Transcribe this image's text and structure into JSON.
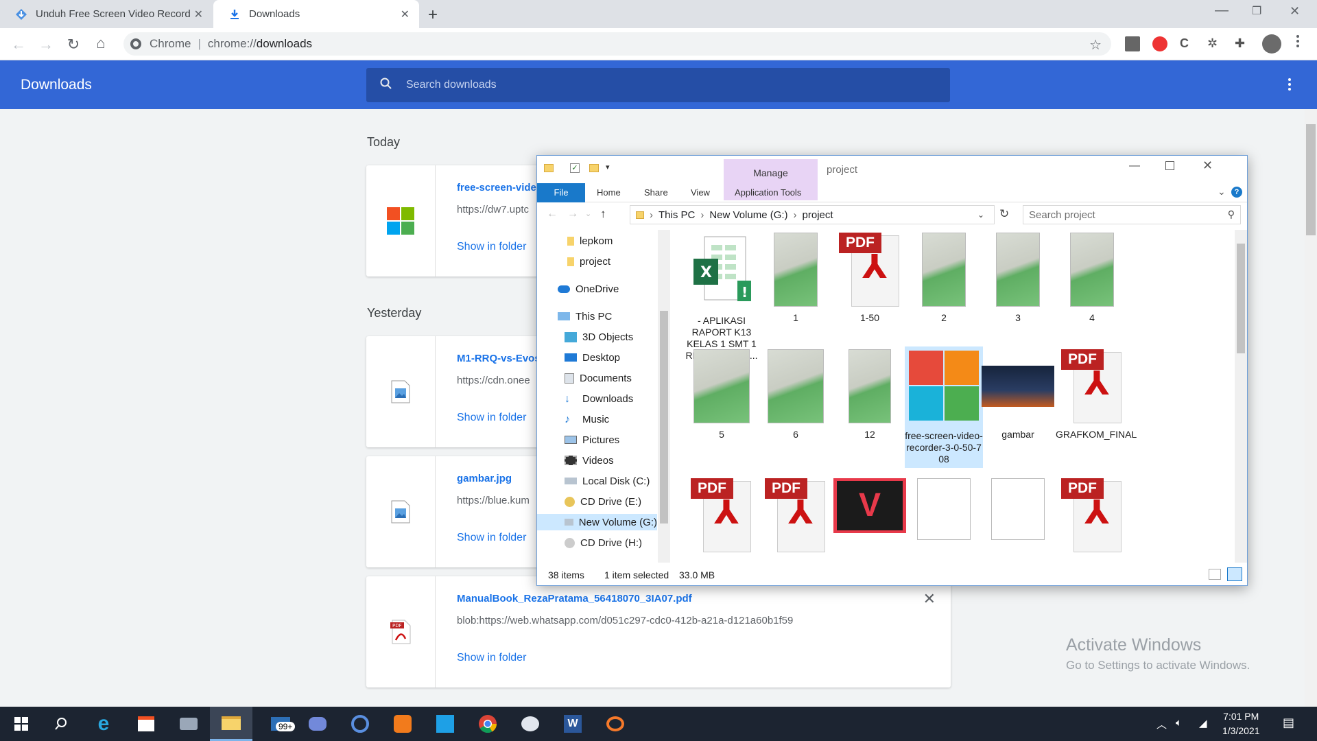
{
  "browser": {
    "tabs": [
      {
        "label": "Unduh Free Screen Video Record",
        "active": false
      },
      {
        "label": "Downloads",
        "active": true
      }
    ],
    "omnibox": {
      "site": "Chrome",
      "url_prefix": "chrome://",
      "url_path": "downloads"
    }
  },
  "downloads": {
    "title": "Downloads",
    "search_placeholder": "Search downloads",
    "sections": [
      {
        "label": "Today",
        "items": [
          {
            "name": "free-screen-vide",
            "url": "https://dw7.uptc",
            "action": "Show in folder",
            "icon": "windows-installer-icon"
          }
        ]
      },
      {
        "label": "Yesterday",
        "items": [
          {
            "name": "M1-RRQ-vs-Evos",
            "url": "https://cdn.onee",
            "action": "Show in folder",
            "icon": "image-file-icon"
          },
          {
            "name": "gambar.jpg",
            "url": "https://blue.kum",
            "action": "Show in folder",
            "icon": "image-file-icon"
          },
          {
            "name": "ManualBook_RezaPratama_56418070_3IA07.pdf",
            "url": "blob:https://web.whatsapp.com/d051c297-cdc0-412b-a21a-d121a60b1f59",
            "action": "Show in folder",
            "icon": "pdf-file-icon"
          }
        ]
      }
    ]
  },
  "explorer": {
    "window_title": "project",
    "context_tab": "Manage",
    "ribbon_tabs": [
      "File",
      "Home",
      "Share",
      "View",
      "Application Tools"
    ],
    "breadcrumb": [
      "This PC",
      "New Volume (G:)",
      "project"
    ],
    "search_placeholder": "Search project",
    "nav": [
      {
        "label": "lepkom",
        "icon": "folder-icon"
      },
      {
        "label": "project",
        "icon": "folder-icon"
      },
      {
        "label": "OneDrive",
        "icon": "onedrive-icon"
      },
      {
        "label": "This PC",
        "icon": "computer-icon"
      },
      {
        "label": "3D Objects",
        "icon": "cube-icon"
      },
      {
        "label": "Desktop",
        "icon": "desktop-icon"
      },
      {
        "label": "Documents",
        "icon": "documents-icon"
      },
      {
        "label": "Downloads",
        "icon": "download-arrow-icon"
      },
      {
        "label": "Music",
        "icon": "music-note-icon"
      },
      {
        "label": "Pictures",
        "icon": "pictures-icon"
      },
      {
        "label": "Videos",
        "icon": "film-icon"
      },
      {
        "label": "Local Disk (C:)",
        "icon": "drive-icon"
      },
      {
        "label": "CD Drive (E:)",
        "icon": "cd-icon"
      },
      {
        "label": "New Volume (G:)",
        "icon": "drive-icon",
        "selected": true
      },
      {
        "label": "CD Drive (H:)",
        "icon": "cd-icon"
      }
    ],
    "files": [
      {
        "label": "- APLIKASI RAPORT K13 KELAS 1 SMT 1 REVISI 2018 - ...",
        "type": "excel"
      },
      {
        "label": "1",
        "type": "photo"
      },
      {
        "label": "1-50",
        "type": "pdf"
      },
      {
        "label": "2",
        "type": "photo"
      },
      {
        "label": "3",
        "type": "photo"
      },
      {
        "label": "4",
        "type": "photo"
      },
      {
        "label": "5",
        "type": "photo"
      },
      {
        "label": "6",
        "type": "photo"
      },
      {
        "label": "12",
        "type": "photo"
      },
      {
        "label": "free-screen-video-recorder-3-0-50-708",
        "type": "installer",
        "selected": true
      },
      {
        "label": "gambar",
        "type": "image"
      },
      {
        "label": "GRAFKOM_FINAL",
        "type": "pdf"
      }
    ],
    "status": {
      "count": "38 items",
      "selected": "1 item selected",
      "size": "33.0 MB"
    }
  },
  "watermark": {
    "line1": "Activate Windows",
    "line2": "Go to Settings to activate Windows."
  },
  "taskbar": {
    "clock_time": "7:01 PM",
    "clock_date": "1/3/2021",
    "mail_badge": "99+"
  }
}
